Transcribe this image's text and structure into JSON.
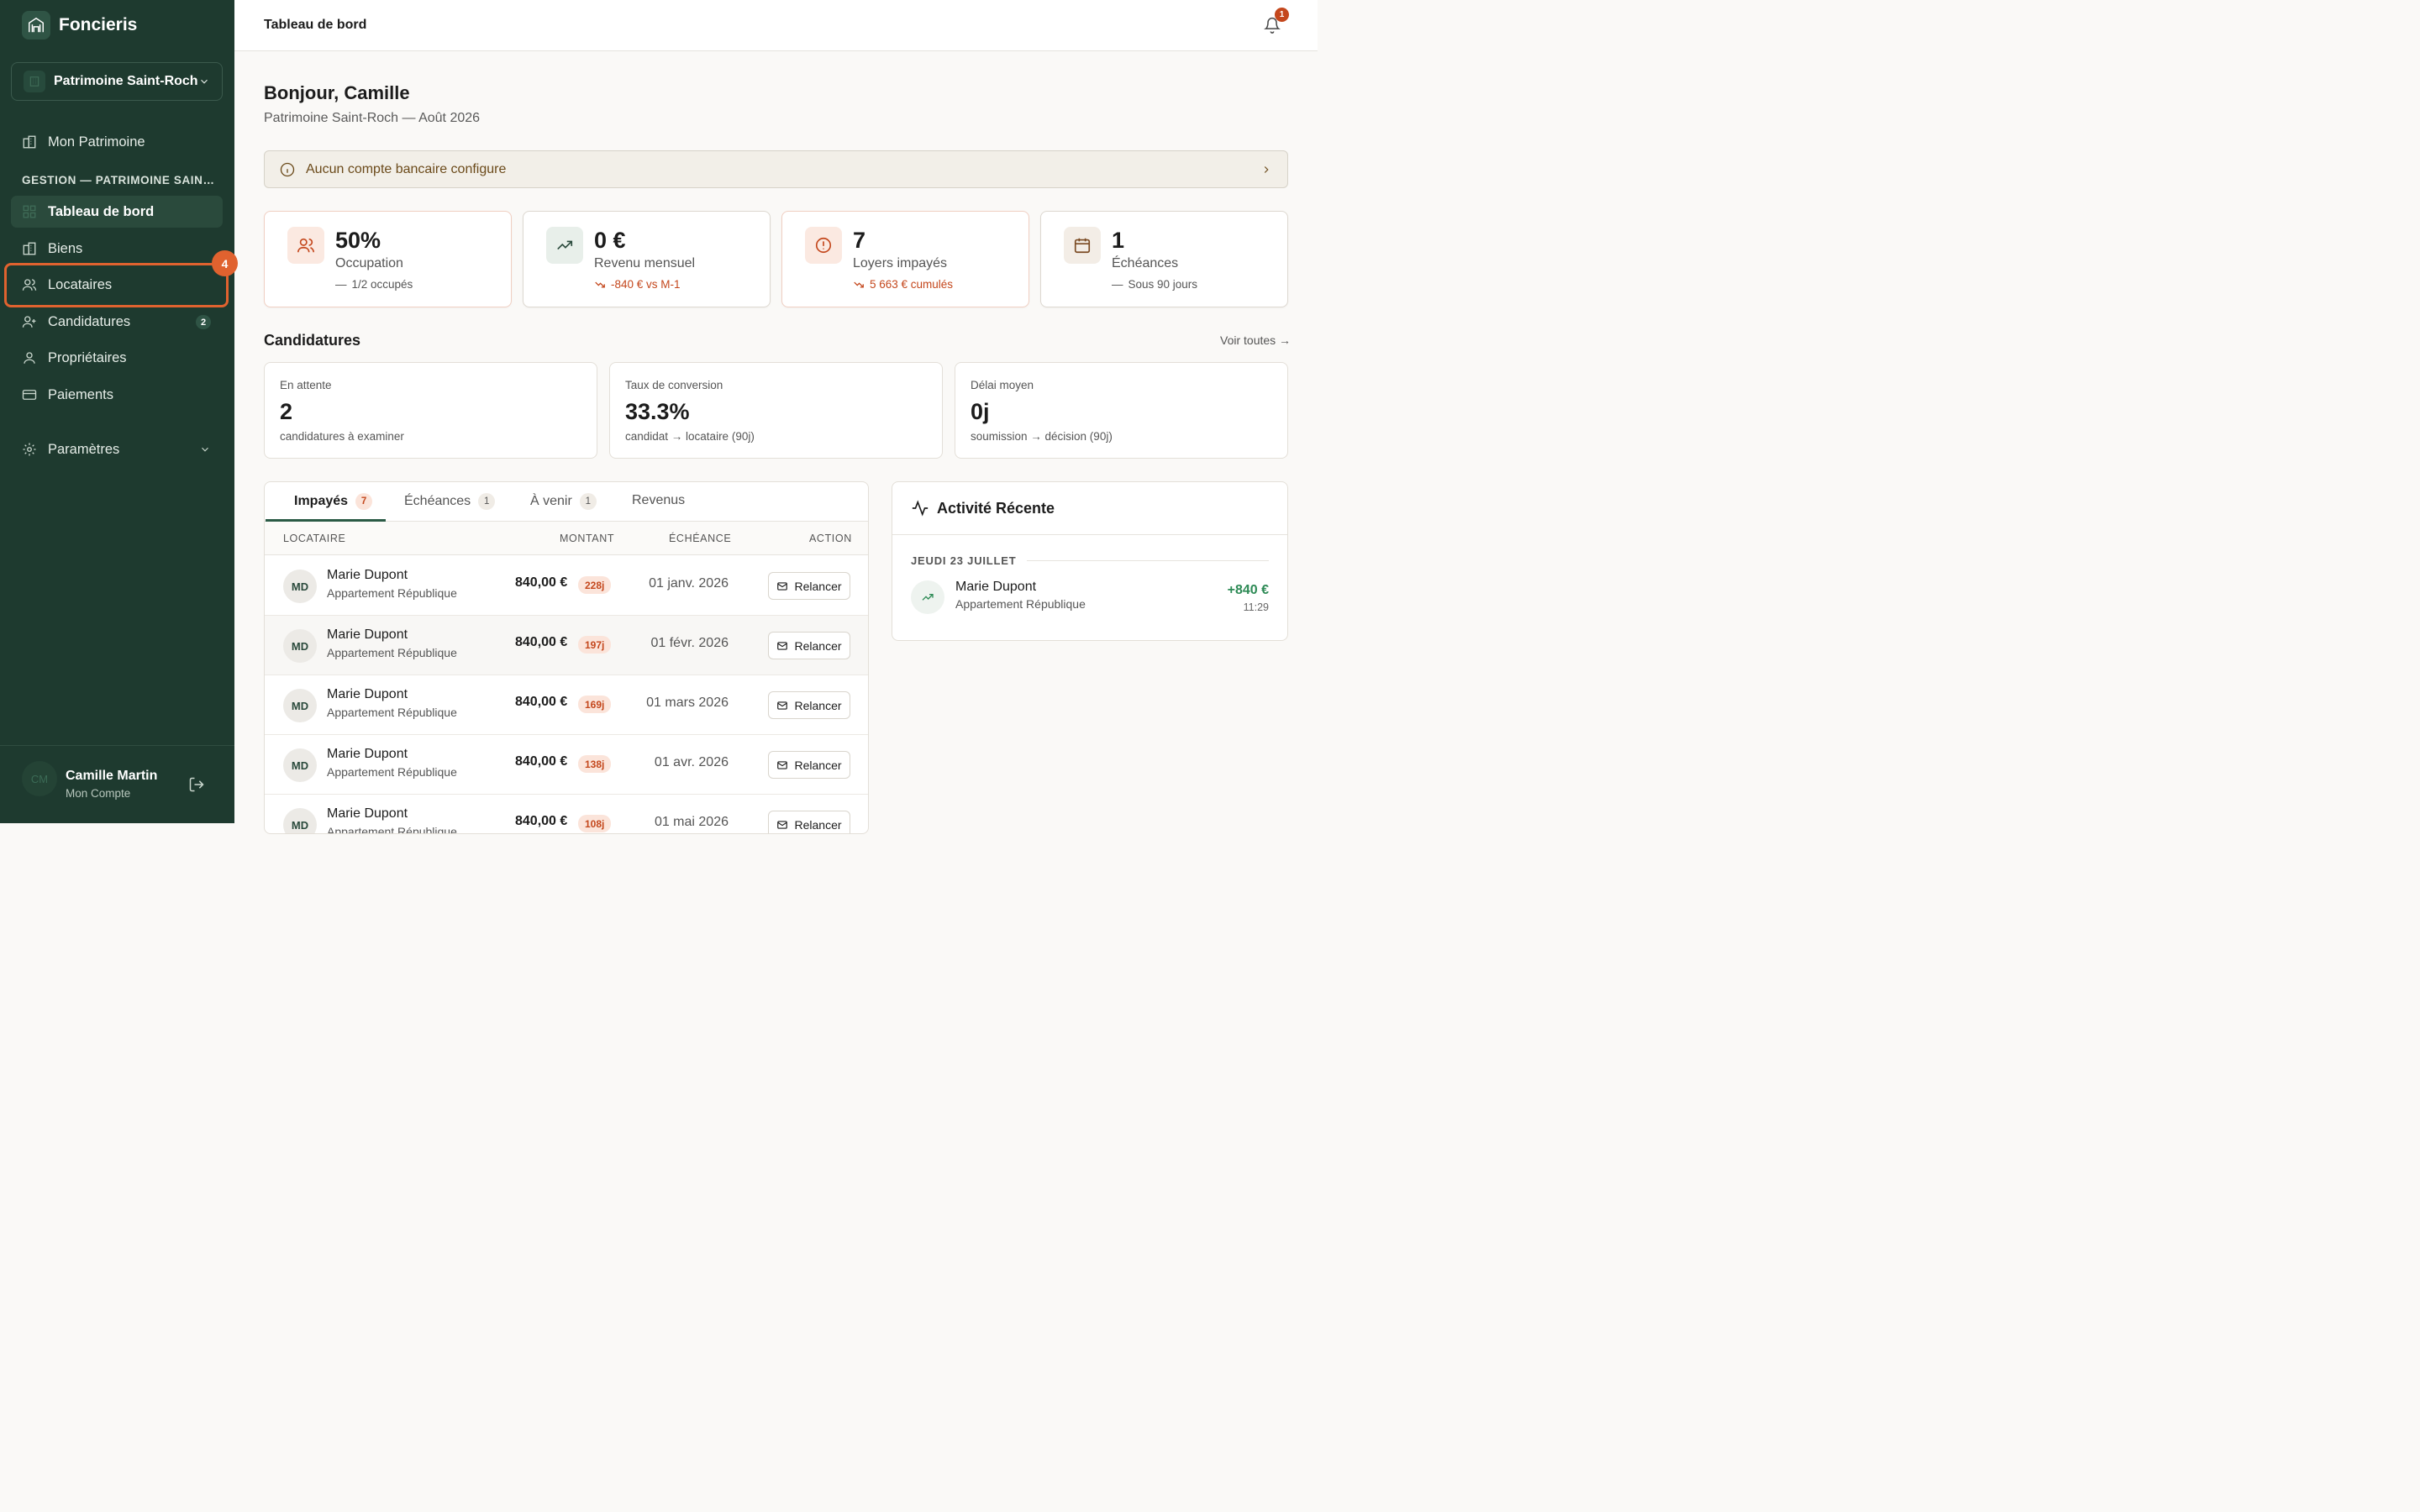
{
  "app": {
    "name": "Foncieris"
  },
  "switcher": {
    "label": "Patrimoine Saint-Roch"
  },
  "sidebar": {
    "top_item": {
      "label": "Mon Patrimoine"
    },
    "section_label": "GESTION — PATRIMOINE SAINT-ROCH",
    "items": [
      {
        "label": "Tableau de bord",
        "active": true
      },
      {
        "label": "Biens"
      },
      {
        "label": "Locataires",
        "highlight_badge": "4"
      },
      {
        "label": "Candidatures",
        "badge": "2"
      },
      {
        "label": "Propriétaires"
      },
      {
        "label": "Paiements"
      }
    ],
    "settings": {
      "label": "Paramètres"
    }
  },
  "user": {
    "initials": "CM",
    "name": "Camille Martin",
    "sub": "Mon Compte"
  },
  "topbar": {
    "breadcrumb": "Tableau de bord",
    "notif_count": "1"
  },
  "page": {
    "greeting": "Bonjour, Camille",
    "subtitle": "Patrimoine Saint-Roch — Août 2026"
  },
  "alert": {
    "text": "Aucun compte bancaire configure"
  },
  "kpis": [
    {
      "value": "50%",
      "label": "Occupation",
      "sub": "1/2 occupés",
      "trend": "neutral"
    },
    {
      "value": "0 €",
      "label": "Revenu mensuel",
      "sub": "-840 € vs M-1",
      "trend": "down"
    },
    {
      "value": "7",
      "label": "Loyers impayés",
      "sub": "5 663 € cumulés",
      "trend": "down"
    },
    {
      "value": "1",
      "label": "Échéances",
      "sub": "Sous 90 jours",
      "trend": "neutral"
    }
  ],
  "candidatures": {
    "title": "Candidatures",
    "link": "Voir toutes →",
    "stats": [
      {
        "label": "En attente",
        "value": "2",
        "sub": "candidatures à examiner"
      },
      {
        "label": "Taux de conversion",
        "value": "33.3%",
        "sub": "candidat → locataire (90j)"
      },
      {
        "label": "Délai moyen",
        "value": "0j",
        "sub": "soumission → décision (90j)"
      }
    ]
  },
  "tabs": [
    {
      "label": "Impayés",
      "count": "7"
    },
    {
      "label": "Échéances",
      "count": "1"
    },
    {
      "label": "À venir",
      "count": "1"
    },
    {
      "label": "Revenus"
    }
  ],
  "table": {
    "headers": {
      "tenant": "LOCATAIRE",
      "amount": "MONTANT",
      "due": "ÉCHÉANCE",
      "action": "ACTION"
    },
    "rows": [
      {
        "initials": "MD",
        "name": "Marie Dupont",
        "property": "Appartement République",
        "amount": "840,00 €",
        "days": "228j",
        "due": "01 janv. 2026",
        "action": "Relancer"
      },
      {
        "initials": "MD",
        "name": "Marie Dupont",
        "property": "Appartement République",
        "amount": "840,00 €",
        "days": "197j",
        "due": "01 févr. 2026",
        "action": "Relancer"
      },
      {
        "initials": "MD",
        "name": "Marie Dupont",
        "property": "Appartement République",
        "amount": "840,00 €",
        "days": "169j",
        "due": "01 mars 2026",
        "action": "Relancer"
      },
      {
        "initials": "MD",
        "name": "Marie Dupont",
        "property": "Appartement République",
        "amount": "840,00 €",
        "days": "138j",
        "due": "01 avr. 2026",
        "action": "Relancer"
      },
      {
        "initials": "MD",
        "name": "Marie Dupont",
        "property": "Appartement République",
        "amount": "840,00 €",
        "days": "108j",
        "due": "01 mai 2026",
        "action": "Relancer"
      }
    ]
  },
  "activity": {
    "title": "Activité Récente",
    "date": "JEUDI 23 JUILLET",
    "item": {
      "name": "Marie Dupont",
      "property": "Appartement République",
      "amount": "+840 €",
      "time": "11:29"
    }
  },
  "colors": {
    "sidebar": "#1e3a2f",
    "accent": "#e0622f",
    "danger": "#c4471c",
    "success": "#2d8a55"
  }
}
